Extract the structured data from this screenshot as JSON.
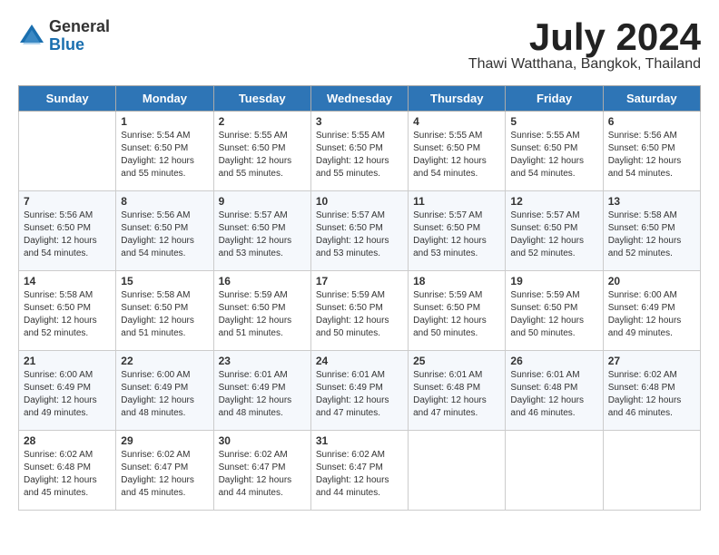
{
  "header": {
    "logo_general": "General",
    "logo_blue": "Blue",
    "month_year": "July 2024",
    "location": "Thawi Watthana, Bangkok, Thailand"
  },
  "days_of_week": [
    "Sunday",
    "Monday",
    "Tuesday",
    "Wednesday",
    "Thursday",
    "Friday",
    "Saturday"
  ],
  "weeks": [
    [
      {
        "day": "",
        "info": ""
      },
      {
        "day": "1",
        "info": "Sunrise: 5:54 AM\nSunset: 6:50 PM\nDaylight: 12 hours\nand 55 minutes."
      },
      {
        "day": "2",
        "info": "Sunrise: 5:55 AM\nSunset: 6:50 PM\nDaylight: 12 hours\nand 55 minutes."
      },
      {
        "day": "3",
        "info": "Sunrise: 5:55 AM\nSunset: 6:50 PM\nDaylight: 12 hours\nand 55 minutes."
      },
      {
        "day": "4",
        "info": "Sunrise: 5:55 AM\nSunset: 6:50 PM\nDaylight: 12 hours\nand 54 minutes."
      },
      {
        "day": "5",
        "info": "Sunrise: 5:55 AM\nSunset: 6:50 PM\nDaylight: 12 hours\nand 54 minutes."
      },
      {
        "day": "6",
        "info": "Sunrise: 5:56 AM\nSunset: 6:50 PM\nDaylight: 12 hours\nand 54 minutes."
      }
    ],
    [
      {
        "day": "7",
        "info": "Sunrise: 5:56 AM\nSunset: 6:50 PM\nDaylight: 12 hours\nand 54 minutes."
      },
      {
        "day": "8",
        "info": "Sunrise: 5:56 AM\nSunset: 6:50 PM\nDaylight: 12 hours\nand 54 minutes."
      },
      {
        "day": "9",
        "info": "Sunrise: 5:57 AM\nSunset: 6:50 PM\nDaylight: 12 hours\nand 53 minutes."
      },
      {
        "day": "10",
        "info": "Sunrise: 5:57 AM\nSunset: 6:50 PM\nDaylight: 12 hours\nand 53 minutes."
      },
      {
        "day": "11",
        "info": "Sunrise: 5:57 AM\nSunset: 6:50 PM\nDaylight: 12 hours\nand 53 minutes."
      },
      {
        "day": "12",
        "info": "Sunrise: 5:57 AM\nSunset: 6:50 PM\nDaylight: 12 hours\nand 52 minutes."
      },
      {
        "day": "13",
        "info": "Sunrise: 5:58 AM\nSunset: 6:50 PM\nDaylight: 12 hours\nand 52 minutes."
      }
    ],
    [
      {
        "day": "14",
        "info": "Sunrise: 5:58 AM\nSunset: 6:50 PM\nDaylight: 12 hours\nand 52 minutes."
      },
      {
        "day": "15",
        "info": "Sunrise: 5:58 AM\nSunset: 6:50 PM\nDaylight: 12 hours\nand 51 minutes."
      },
      {
        "day": "16",
        "info": "Sunrise: 5:59 AM\nSunset: 6:50 PM\nDaylight: 12 hours\nand 51 minutes."
      },
      {
        "day": "17",
        "info": "Sunrise: 5:59 AM\nSunset: 6:50 PM\nDaylight: 12 hours\nand 50 minutes."
      },
      {
        "day": "18",
        "info": "Sunrise: 5:59 AM\nSunset: 6:50 PM\nDaylight: 12 hours\nand 50 minutes."
      },
      {
        "day": "19",
        "info": "Sunrise: 5:59 AM\nSunset: 6:50 PM\nDaylight: 12 hours\nand 50 minutes."
      },
      {
        "day": "20",
        "info": "Sunrise: 6:00 AM\nSunset: 6:49 PM\nDaylight: 12 hours\nand 49 minutes."
      }
    ],
    [
      {
        "day": "21",
        "info": "Sunrise: 6:00 AM\nSunset: 6:49 PM\nDaylight: 12 hours\nand 49 minutes."
      },
      {
        "day": "22",
        "info": "Sunrise: 6:00 AM\nSunset: 6:49 PM\nDaylight: 12 hours\nand 48 minutes."
      },
      {
        "day": "23",
        "info": "Sunrise: 6:01 AM\nSunset: 6:49 PM\nDaylight: 12 hours\nand 48 minutes."
      },
      {
        "day": "24",
        "info": "Sunrise: 6:01 AM\nSunset: 6:49 PM\nDaylight: 12 hours\nand 47 minutes."
      },
      {
        "day": "25",
        "info": "Sunrise: 6:01 AM\nSunset: 6:48 PM\nDaylight: 12 hours\nand 47 minutes."
      },
      {
        "day": "26",
        "info": "Sunrise: 6:01 AM\nSunset: 6:48 PM\nDaylight: 12 hours\nand 46 minutes."
      },
      {
        "day": "27",
        "info": "Sunrise: 6:02 AM\nSunset: 6:48 PM\nDaylight: 12 hours\nand 46 minutes."
      }
    ],
    [
      {
        "day": "28",
        "info": "Sunrise: 6:02 AM\nSunset: 6:48 PM\nDaylight: 12 hours\nand 45 minutes."
      },
      {
        "day": "29",
        "info": "Sunrise: 6:02 AM\nSunset: 6:47 PM\nDaylight: 12 hours\nand 45 minutes."
      },
      {
        "day": "30",
        "info": "Sunrise: 6:02 AM\nSunset: 6:47 PM\nDaylight: 12 hours\nand 44 minutes."
      },
      {
        "day": "31",
        "info": "Sunrise: 6:02 AM\nSunset: 6:47 PM\nDaylight: 12 hours\nand 44 minutes."
      },
      {
        "day": "",
        "info": ""
      },
      {
        "day": "",
        "info": ""
      },
      {
        "day": "",
        "info": ""
      }
    ]
  ]
}
